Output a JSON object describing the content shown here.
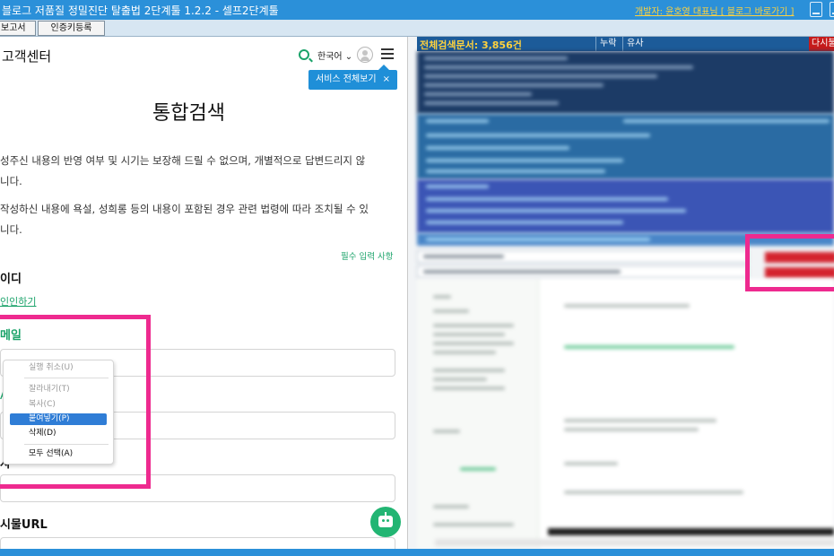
{
  "window": {
    "title": "블로그 저품질 정밀진단 탈출법 2단계툴 1.2.2 - 셀프2단계툴",
    "developer_link": "개발자: 윤호영 대표님 [ 블로그 바로가기 ]"
  },
  "toolbar": {
    "tabs": [
      "보고서",
      "인증키등록"
    ]
  },
  "webpage": {
    "brand": "고객센터",
    "language": "한국어",
    "tooltip": "서비스 전체보기",
    "tooltip_close": "×",
    "page_title": "통합검색",
    "notice1": "성주신 내용의 반영 여부 및 시기는 보장해 드릴 수 없으며, 개별적으로 답변드리지 않",
    "notice1b": "니다.",
    "notice2": "작성하신 내용에 욕설, 성희롱 등의 내용이 포함된 경우 관련 법령에 따라 조치될 수 있",
    "notice2b": "니다.",
    "required_note": "필수 입력 사항",
    "section_id": "이디",
    "verify_link": "인인하기",
    "email_label": "메일",
    "label_a": "A",
    "label_b": "사",
    "section_url": "시물URL"
  },
  "context_menu": {
    "items": [
      {
        "label": "실행 취소(U)",
        "enabled": false
      },
      {
        "label": "잘라내기(T)",
        "enabled": false
      },
      {
        "label": "복사(C)",
        "enabled": false
      },
      {
        "label": "붙여넣기(P)",
        "enabled": true,
        "selected": true
      },
      {
        "label": "삭제(D)",
        "enabled": true
      },
      {
        "label": "모두 선택(A)",
        "enabled": true
      }
    ]
  },
  "app_panel": {
    "total_count_label": "전체검색문서: 3,856건",
    "tabs": [
      "누락",
      "유사"
    ],
    "reload_label": "다시불러"
  },
  "colors": {
    "titlebar": "#2b90d9",
    "highlight": "#ee2a8f",
    "green_accent": "#1ba36a",
    "tooltip": "#1f8fd8",
    "reload_red": "#c61b1b"
  }
}
